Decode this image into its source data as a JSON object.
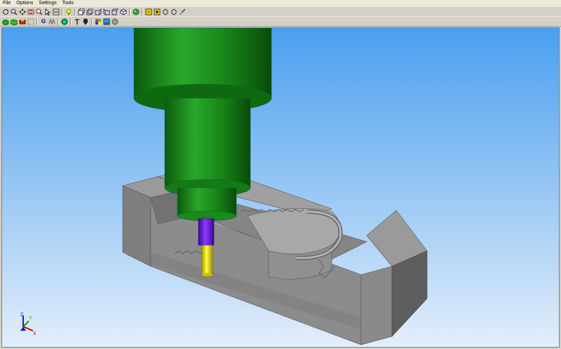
{
  "menu": {
    "items": [
      {
        "label": "File"
      },
      {
        "label": "Options"
      },
      {
        "label": "Settings"
      },
      {
        "label": "Tools"
      }
    ]
  },
  "toolbar1": {
    "icons": [
      "rotate-icon",
      "zoom-window-icon",
      "pan-icon",
      "zoom-fit-icon",
      "zoom-icon",
      "select-icon",
      "layers-icon",
      "light-bulb-icon",
      "view-front-icon",
      "view-back-icon",
      "view-left-icon",
      "view-right-icon",
      "view-top-icon",
      "view-iso-icon",
      "render-sphere-icon",
      "shaded-icon",
      "wireframe-icon",
      "hidden-line-icon",
      "outline-icon",
      "brush-icon"
    ]
  },
  "toolbar2": {
    "icons": [
      "stock-green-icon",
      "part-green-icon",
      "fixture-icon",
      "machine-icon",
      "gcode-icon",
      "toolpath-icon",
      "target-icon",
      "tool-holder-icon",
      "tool-icon",
      "color-icon",
      "image-icon",
      "sphere-icon"
    ],
    "gcode_glyph": "G"
  },
  "viewport": {
    "background_top": "#4a9ff0",
    "background_bottom": "#e4eefa",
    "stock_color": "#8c8c8c",
    "spindle_color": "#1a8a1a",
    "holder_color": "#6a1ad8",
    "tool_color": "#f0e000",
    "axes": {
      "x_label": "X",
      "y_label": "Y",
      "z_label": "Z"
    }
  }
}
